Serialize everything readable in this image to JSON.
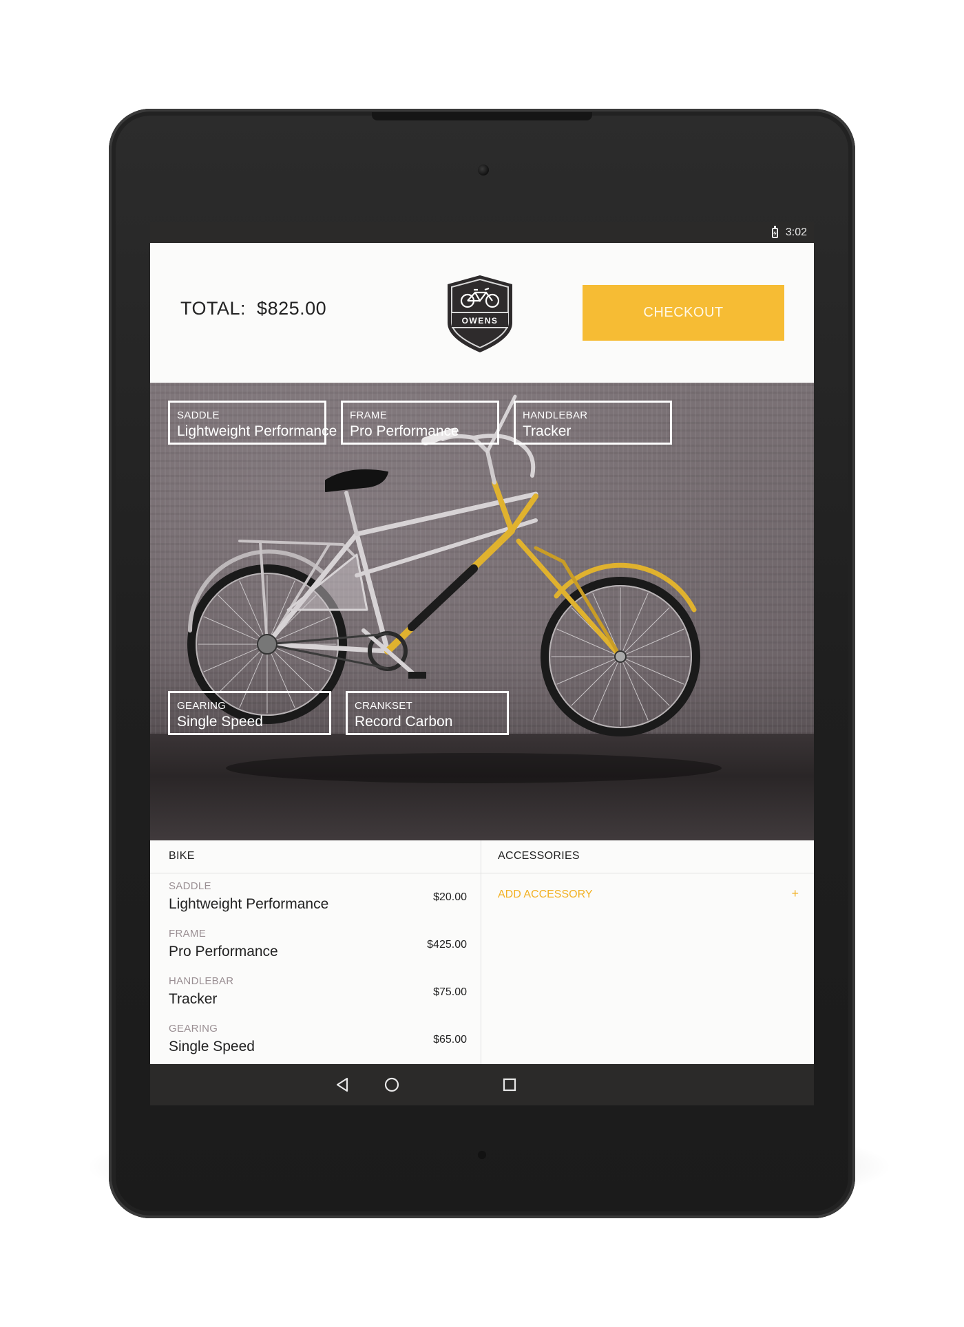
{
  "status_bar": {
    "time": "3:02"
  },
  "header": {
    "total_label": "TOTAL:",
    "total_amount": "$825.00",
    "logo_text": "OWENS",
    "checkout_label": "CHECKOUT"
  },
  "colors": {
    "accent": "#f6bc34",
    "accent_text": "#f2b124"
  },
  "hero_tags": {
    "saddle": {
      "label": "SADDLE",
      "value": "Lightweight Performance"
    },
    "frame": {
      "label": "FRAME",
      "value": "Pro Performance"
    },
    "handlebar": {
      "label": "HANDLEBAR",
      "value": "Tracker"
    },
    "gearing": {
      "label": "GEARING",
      "value": "Single Speed"
    },
    "crankset": {
      "label": "CRANKSET",
      "value": "Record Carbon"
    }
  },
  "bike_panel": {
    "title": "BIKE",
    "items": [
      {
        "label": "SADDLE",
        "value": "Lightweight Performance",
        "price": "$20.00"
      },
      {
        "label": "FRAME",
        "value": "Pro Performance",
        "price": "$425.00"
      },
      {
        "label": "HANDLEBAR",
        "value": "Tracker",
        "price": "$75.00"
      },
      {
        "label": "GEARING",
        "value": "Single Speed",
        "price": "$65.00"
      }
    ]
  },
  "accessories_panel": {
    "title": "ACCESSORIES",
    "add_label": "ADD ACCESSORY",
    "add_icon": "+"
  },
  "nav_bar": {
    "icons": [
      "back-icon",
      "home-icon",
      "recents-icon"
    ]
  }
}
